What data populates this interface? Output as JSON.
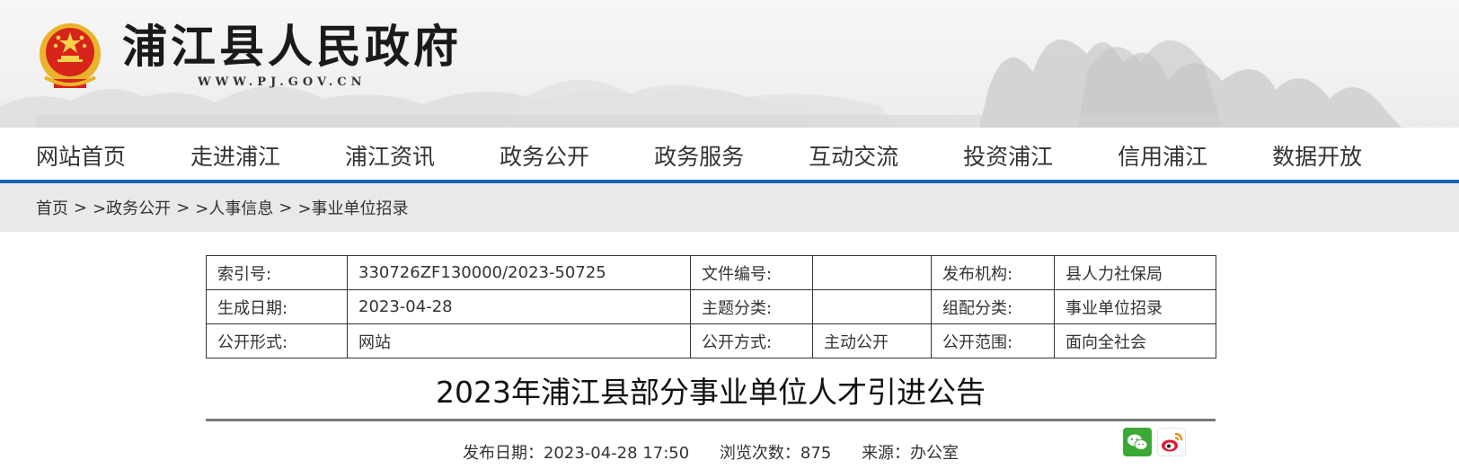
{
  "header": {
    "title": "浦江县人民政府",
    "url": "WWW.PJ.GOV.CN"
  },
  "nav": {
    "items": [
      "网站首页",
      "走进浦江",
      "浦江资讯",
      "政务公开",
      "政务服务",
      "互动交流",
      "投资浦江",
      "信用浦江",
      "数据开放"
    ]
  },
  "breadcrumb": {
    "items": [
      "首页",
      ">政务公开",
      ">人事信息",
      ">事业单位招录"
    ],
    "separator": ">"
  },
  "meta": {
    "rows": [
      [
        "索引号:",
        "330726ZF130000/2023-50725",
        "文件编号:",
        "",
        "发布机构:",
        "县人力社保局"
      ],
      [
        "生成日期:",
        "2023-04-28",
        "主题分类:",
        "",
        "组配分类:",
        "事业单位招录"
      ],
      [
        "公开形式:",
        "网站",
        "公开方式:",
        "主动公开",
        "公开范围:",
        "面向全社会"
      ]
    ]
  },
  "article": {
    "title": "2023年浦江县部分事业单位人才引进公告",
    "publish_date": "发布日期：2023-04-28 17:50",
    "views": "浏览次数：875",
    "source": "来源：办公室"
  },
  "colors": {
    "accent": "#1a62b7",
    "emblem_red": "#d7231a",
    "emblem_gold": "#e9b32a",
    "wechat_green": "#3aaa35",
    "weibo_red": "#e6162d"
  },
  "icons": [
    "national-emblem-icon",
    "wechat-icon",
    "weibo-icon"
  ]
}
